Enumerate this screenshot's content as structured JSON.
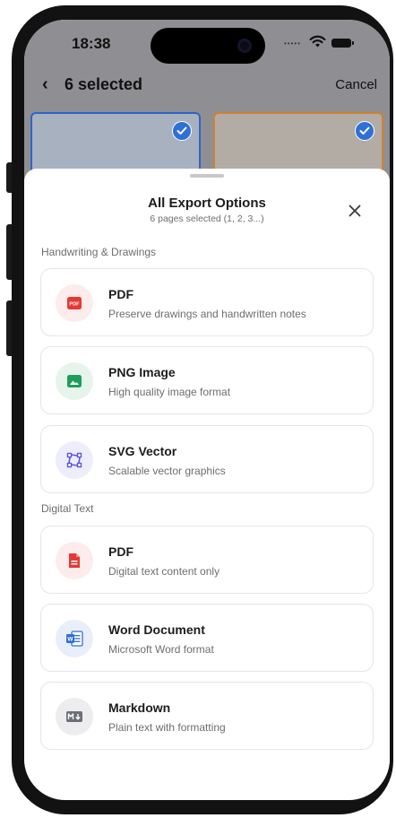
{
  "status_bar": {
    "time": "18:38"
  },
  "nav": {
    "title": "6 selected",
    "cancel_label": "Cancel"
  },
  "sheet": {
    "title": "All Export Options",
    "subtitle": "6 pages selected (1, 2, 3...)",
    "close_icon": "close-icon",
    "sections": [
      {
        "label": "Handwriting & Drawings",
        "options": [
          {
            "title": "PDF",
            "description": "Preserve drawings and handwritten notes",
            "icon": "pdf-badge-icon",
            "color": "#e53935"
          },
          {
            "title": "PNG Image",
            "description": "High quality image format",
            "icon": "image-icon",
            "color": "#1e9e5a"
          },
          {
            "title": "SVG Vector",
            "description": "Scalable vector graphics",
            "icon": "vector-path-icon",
            "color": "#5b55d6"
          }
        ]
      },
      {
        "label": "Digital Text",
        "options": [
          {
            "title": "PDF",
            "description": "Digital text content only",
            "icon": "document-icon",
            "color": "#e53935"
          },
          {
            "title": "Word Document",
            "description": "Microsoft Word format",
            "icon": "word-icon",
            "color": "#2f6fd8"
          },
          {
            "title": "Markdown",
            "description": "Plain text with formatting",
            "icon": "markdown-icon",
            "color": "#6b6f78"
          }
        ]
      }
    ]
  },
  "colors": {
    "selection_blue": "#2f6fd8",
    "selection_orange": "#cf8230",
    "dim_overlay": "#8f8f93"
  }
}
